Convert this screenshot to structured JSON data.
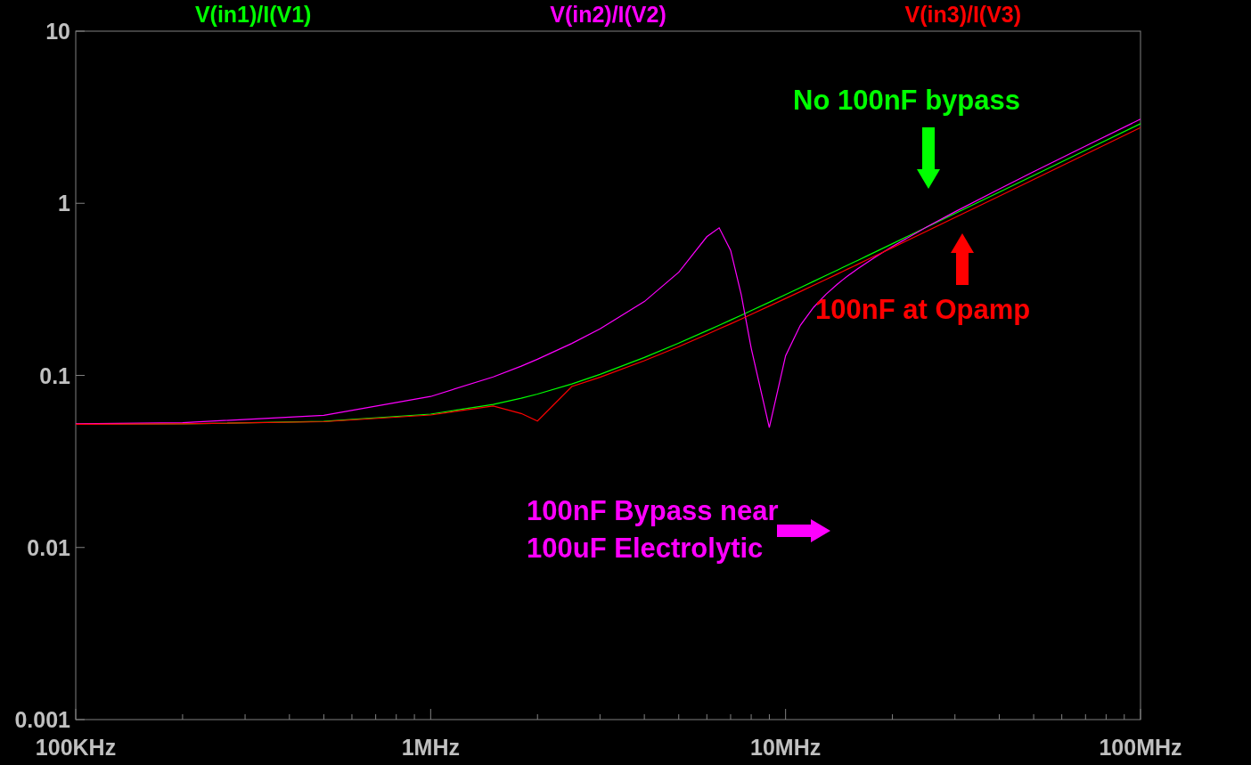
{
  "plot": {
    "traces": [
      {
        "name": "V(in1)/I(V1)",
        "color": "#00ff00"
      },
      {
        "name": "V(in2)/I(V2)",
        "color": "#ff00ff"
      },
      {
        "name": "V(in3)/I(V3)",
        "color": "#ff0000"
      }
    ],
    "x_axis_labels": [
      "100KHz",
      "1MHz",
      "10MHz",
      "100MHz"
    ],
    "y_axis_labels": [
      "10",
      "1",
      "0.1",
      "0.01",
      "0.001"
    ],
    "callouts": [
      {
        "text": "No 100nF bypass",
        "color": "#00ff00"
      },
      {
        "text": "100nF at Opamp",
        "color": "#ff0000"
      },
      {
        "text": "100nF Bypass near",
        "color": "#ff00ff"
      },
      {
        "text": "100uF Electrolytic",
        "color": "#ff00ff"
      }
    ]
  }
}
